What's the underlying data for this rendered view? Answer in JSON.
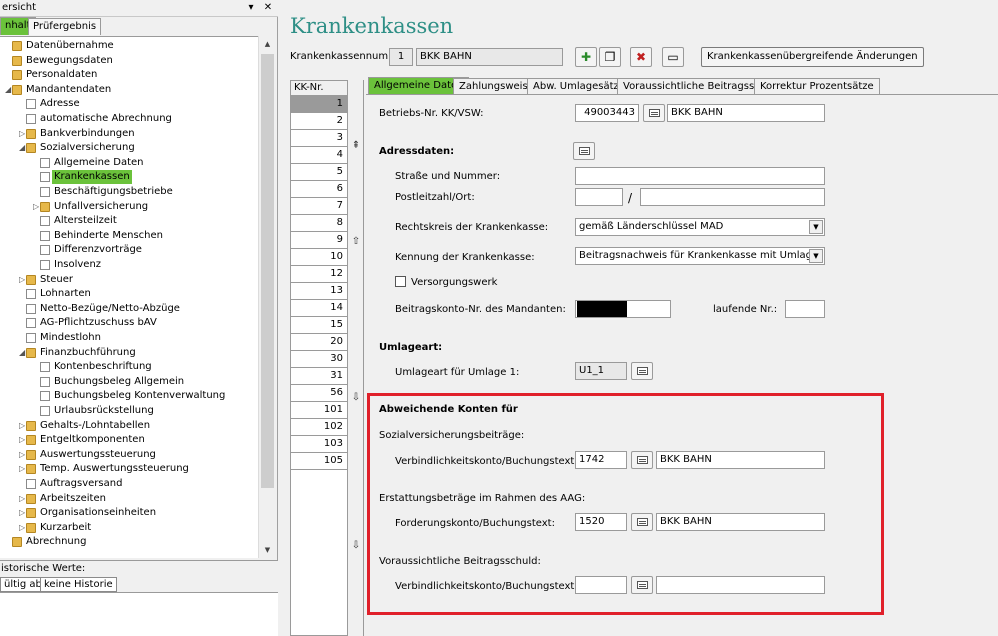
{
  "left": {
    "panel_title": "ersicht",
    "tabs": [
      {
        "label": "nhalt"
      },
      {
        "label": "Prüfergebnis"
      }
    ],
    "tree": [
      {
        "label": "Datenübernahme",
        "type": "folder",
        "level": 0,
        "exp": ""
      },
      {
        "label": "Bewegungsdaten",
        "type": "folder",
        "level": 0,
        "exp": ""
      },
      {
        "label": "Personaldaten",
        "type": "folder",
        "level": 0,
        "exp": ""
      },
      {
        "label": "Mandantendaten",
        "type": "folder",
        "level": 0,
        "exp": "◢"
      },
      {
        "label": "Adresse",
        "type": "doc",
        "level": 1,
        "exp": ""
      },
      {
        "label": "automatische Abrechnung",
        "type": "doc",
        "level": 1,
        "exp": ""
      },
      {
        "label": "Bankverbindungen",
        "type": "folder",
        "level": 1,
        "exp": "▷"
      },
      {
        "label": "Sozialversicherung",
        "type": "folder",
        "level": 1,
        "exp": "◢"
      },
      {
        "label": "Allgemeine Daten",
        "type": "doc",
        "level": 2,
        "exp": ""
      },
      {
        "label": "Krankenkassen",
        "type": "doc",
        "level": 2,
        "exp": "",
        "selected": true
      },
      {
        "label": "Beschäftigungsbetriebe",
        "type": "doc",
        "level": 2,
        "exp": ""
      },
      {
        "label": "Unfallversicherung",
        "type": "folder",
        "level": 2,
        "exp": "▷"
      },
      {
        "label": "Altersteilzeit",
        "type": "doc",
        "level": 2,
        "exp": ""
      },
      {
        "label": "Behinderte Menschen",
        "type": "doc",
        "level": 2,
        "exp": ""
      },
      {
        "label": "Differenzvorträge",
        "type": "doc",
        "level": 2,
        "exp": ""
      },
      {
        "label": "Insolvenz",
        "type": "doc",
        "level": 2,
        "exp": ""
      },
      {
        "label": "Steuer",
        "type": "folder",
        "level": 1,
        "exp": "▷"
      },
      {
        "label": "Lohnarten",
        "type": "doc",
        "level": 1,
        "exp": ""
      },
      {
        "label": "Netto-Bezüge/Netto-Abzüge",
        "type": "doc",
        "level": 1,
        "exp": ""
      },
      {
        "label": "AG-Pflichtzuschuss bAV",
        "type": "doc",
        "level": 1,
        "exp": ""
      },
      {
        "label": "Mindestlohn",
        "type": "doc",
        "level": 1,
        "exp": ""
      },
      {
        "label": "Finanzbuchführung",
        "type": "folder",
        "level": 1,
        "exp": "◢"
      },
      {
        "label": "Kontenbeschriftung",
        "type": "doc",
        "level": 2,
        "exp": ""
      },
      {
        "label": "Buchungsbeleg Allgemein",
        "type": "doc",
        "level": 2,
        "exp": ""
      },
      {
        "label": "Buchungsbeleg Kontenverwaltung",
        "type": "doc",
        "level": 2,
        "exp": ""
      },
      {
        "label": "Urlaubsrückstellung",
        "type": "doc",
        "level": 2,
        "exp": ""
      },
      {
        "label": "Gehalts-/Lohntabellen",
        "type": "folder",
        "level": 1,
        "exp": "▷"
      },
      {
        "label": "Entgeltkomponenten",
        "type": "folder",
        "level": 1,
        "exp": "▷"
      },
      {
        "label": "Auswertungssteuerung",
        "type": "folder",
        "level": 1,
        "exp": "▷"
      },
      {
        "label": "Temp. Auswertungssteuerung",
        "type": "folder",
        "level": 1,
        "exp": "▷"
      },
      {
        "label": "Auftragsversand",
        "type": "doc",
        "level": 1,
        "exp": ""
      },
      {
        "label": "Arbeitszeiten",
        "type": "folder",
        "level": 1,
        "exp": "▷"
      },
      {
        "label": "Organisationseinheiten",
        "type": "folder",
        "level": 1,
        "exp": "▷"
      },
      {
        "label": "Kurzarbeit",
        "type": "folder",
        "level": 1,
        "exp": "▷"
      },
      {
        "label": "Abrechnung",
        "type": "folder",
        "level": 0,
        "exp": ""
      }
    ],
    "history": {
      "title": "istorische Werte:",
      "btn1": "ültig ab",
      "btn2": "keine Historie"
    }
  },
  "main": {
    "title": "Krankenkassen",
    "kk_number_label": "Krankenkassennummer:",
    "kk_number": "1",
    "kk_name": "BKK BAHN",
    "cross_changes_button": "Krankenkassenübergreifende Änderungen",
    "kk_list_header": "KK-Nr.",
    "kk_list": [
      "1",
      "2",
      "3",
      "4",
      "5",
      "6",
      "7",
      "8",
      "9",
      "10",
      "12",
      "13",
      "14",
      "15",
      "20",
      "30",
      "31",
      "56",
      "101",
      "102",
      "103",
      "105"
    ],
    "tabs": [
      {
        "label": "Allgemeine Daten"
      },
      {
        "label": "Zahlungsweise"
      },
      {
        "label": "Abw. Umlagesätze"
      },
      {
        "label": "Voraussichtliche Beitragsschuld"
      },
      {
        "label": "Korrektur Prozentsätze"
      }
    ],
    "betriebsnr_label": "Betriebs-Nr. KK/VSW:",
    "betriebsnr": "49003443",
    "betriebsnr_name": "BKK BAHN",
    "adress_title": "Adressdaten:",
    "strasse_label": "Straße und Nummer:",
    "strasse": "",
    "plz_label": "Postleitzahl/Ort:",
    "plz_sep": "/",
    "rechtskreis_label": "Rechtskreis der Krankenkasse:",
    "rechtskreis": "gemäß Länderschlüssel MAD",
    "kennung_label": "Kennung der Krankenkasse:",
    "kennung": "Beitragsnachweis für Krankenkasse mit Umlage",
    "versorgungswerk_label": "Versorgungswerk",
    "beitragskonto_label": "Beitragskonto-Nr. des Mandanten:",
    "laufende_label": "laufende Nr.:",
    "umlage_title": "Umlageart:",
    "umlage1_label": "Umlageart für Umlage 1:",
    "umlage1": "U1_1",
    "abw_title": "Abweichende Konten für",
    "sv_label": "Sozialversicherungsbeiträge:",
    "vb_label": "Verbindlichkeitskonto/Buchungstext:",
    "sv_konto": "1742",
    "sv_text": "BKK BAHN",
    "aag_label": "Erstattungsbeträge im Rahmen des AAG:",
    "fk_label": "Forderungskonto/Buchungstext:",
    "aag_konto": "1520",
    "aag_text": "BKK BAHN",
    "vbs_label": "Voraussichtliche Beitragsschuld:",
    "vb2_label": "Verbindlichkeitskonto/Buchungstext:",
    "accent": "#6bc23b",
    "title_color": "#2e8f86",
    "highlight_color": "#e0202a"
  }
}
